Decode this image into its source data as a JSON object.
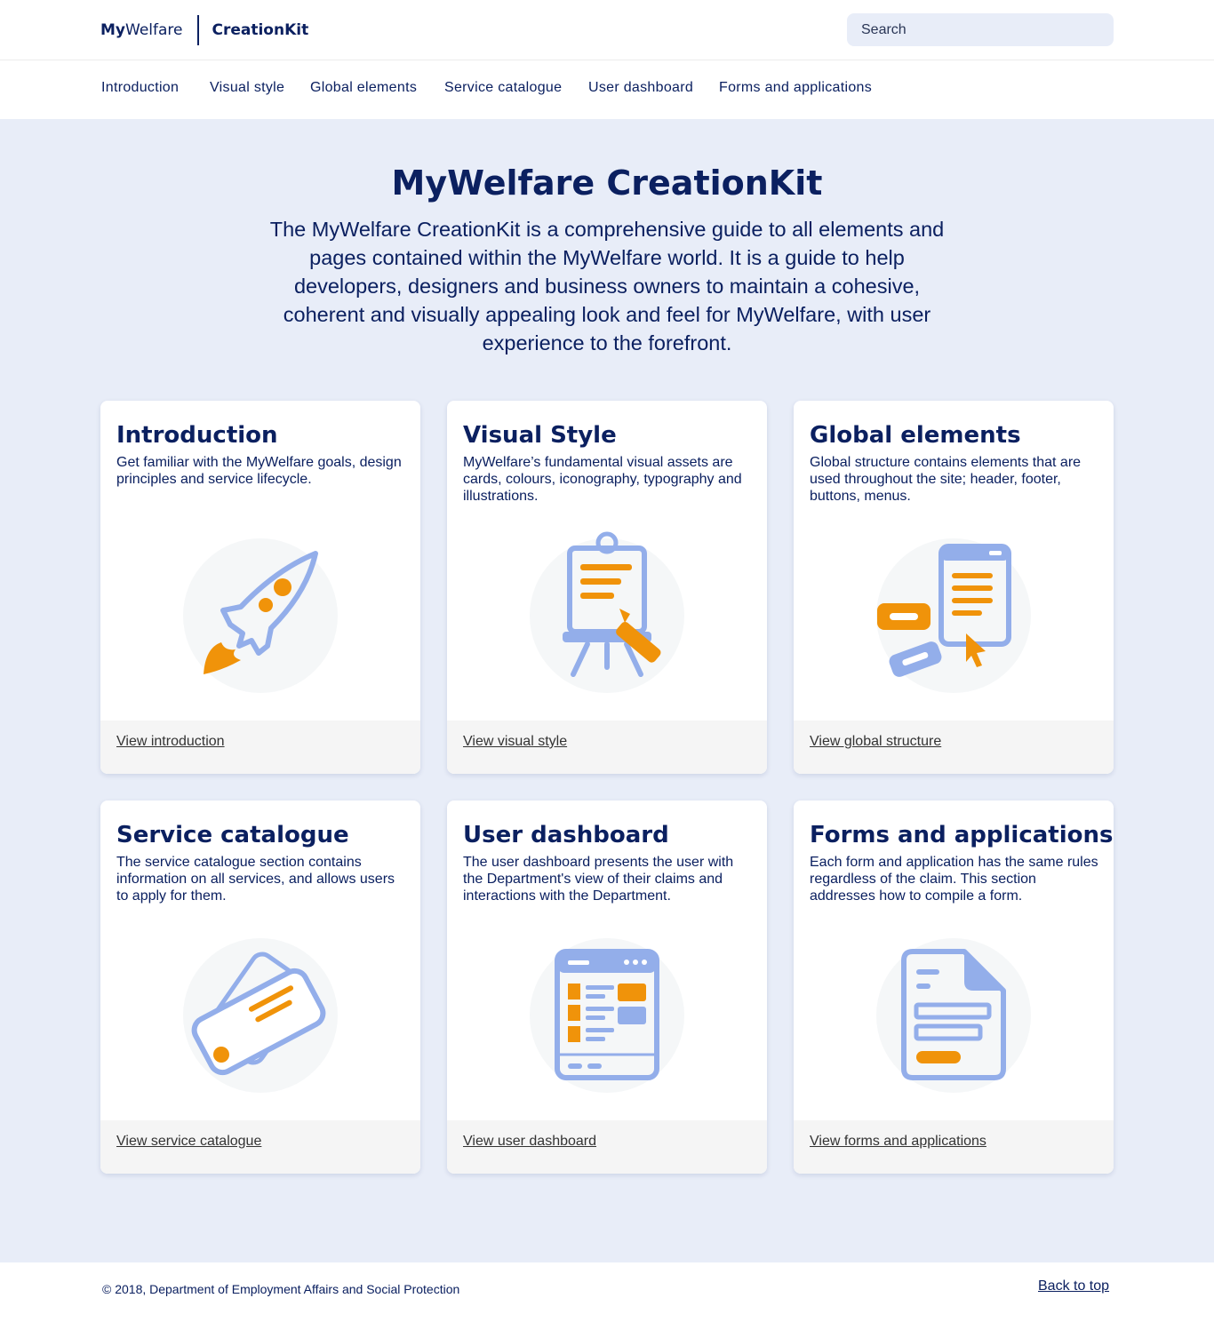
{
  "header": {
    "logo_my_bold": "My",
    "logo_my_light": "Welfare",
    "logo_kit": "CreationKit",
    "search_placeholder": "Search"
  },
  "nav": {
    "items": [
      "Introduction",
      "Visual style",
      "Global elements",
      "Service catalogue",
      "User dashboard",
      "Forms and applications"
    ]
  },
  "hero": {
    "title": "MyWelfare CreationKit",
    "text": "The MyWelfare CreationKit is a comprehensive guide to all elements and pages contained within the MyWelfare world. It is a guide to help developers, designers and business owners to maintain a cohesive, coherent and visually appealing look and feel for MyWelfare, with user experience to the forefront."
  },
  "cards": [
    {
      "title": "Introduction",
      "desc": "Get familiar with the MyWelfare goals, design principles and service lifecycle.",
      "link": "View introduction",
      "icon": "rocket-icon"
    },
    {
      "title": "Visual Style",
      "desc": "MyWelfare’s fundamental visual assets are cards, colours, iconography, typography and illustrations.",
      "link": "View visual style",
      "icon": "easel-icon"
    },
    {
      "title": "Global elements",
      "desc": "Global structure contains elements that are used throughout the site; header, footer, buttons, menus.",
      "link": "View global structure",
      "icon": "ui-elements-icon"
    },
    {
      "title": "Service catalogue",
      "desc": "The service catalogue section contains information on all services, and allows users to apply for them.",
      "link": "View service catalogue",
      "icon": "cards-icon"
    },
    {
      "title": "User dashboard",
      "desc": "The user dashboard presents the user with the Department's view of their claims and interactions with the Department.",
      "link": "View user dashboard",
      "icon": "dashboard-icon"
    },
    {
      "title": "Forms and applications",
      "desc": "Each form and application has the same rules regardless of the claim. This section addresses how to compile a form.",
      "link": "View forms and applications",
      "icon": "document-icon"
    }
  ],
  "colors": {
    "navy": "#0b2060",
    "accent_orange": "#f0930a",
    "accent_blue": "#93aeea",
    "background": "#e8edf8"
  },
  "footer": {
    "copyright": "© 2018, Department of Employment Affairs and Social Protection",
    "back_to_top": "Back to top"
  }
}
